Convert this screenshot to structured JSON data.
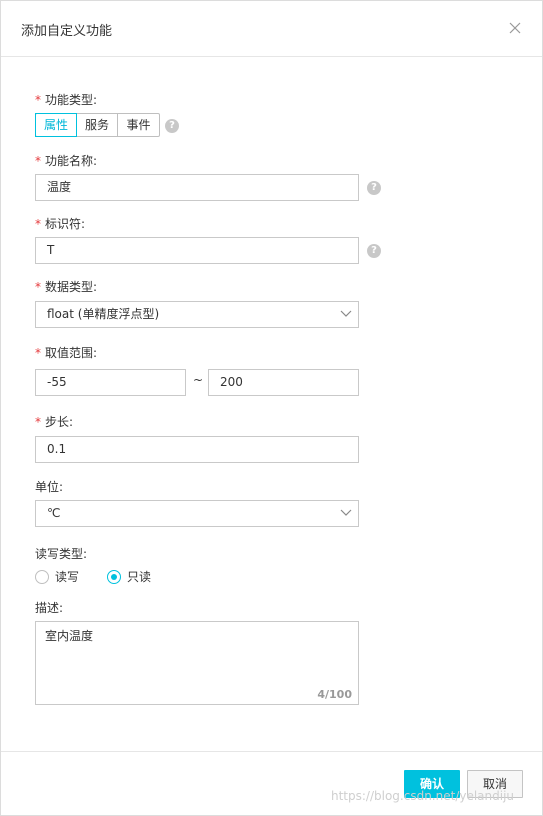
{
  "dialog": {
    "title": "添加自定义功能"
  },
  "form": {
    "required_mark": "*",
    "function_type": {
      "label": "功能类型:",
      "options": [
        "属性",
        "服务",
        "事件"
      ],
      "selected": "属性"
    },
    "function_name": {
      "label": "功能名称:",
      "value": "温度"
    },
    "identifier": {
      "label": "标识符:",
      "value": "T"
    },
    "data_type": {
      "label": "数据类型:",
      "value": "float (单精度浮点型)"
    },
    "value_range": {
      "label": "取值范围:",
      "min": "-55",
      "separator": "~",
      "max": "200"
    },
    "step": {
      "label": "步长:",
      "value": "0.1"
    },
    "unit": {
      "label": "单位:",
      "value": "℃"
    },
    "rw_type": {
      "label": "读写类型:",
      "options": [
        "读写",
        "只读"
      ],
      "selected": "只读"
    },
    "description": {
      "label": "描述:",
      "value": "室内温度",
      "counter": "4/100"
    }
  },
  "footer": {
    "confirm_label": "确认",
    "cancel_label": "取消"
  },
  "watermark": "https://blog.csdn.net/yelandiju"
}
